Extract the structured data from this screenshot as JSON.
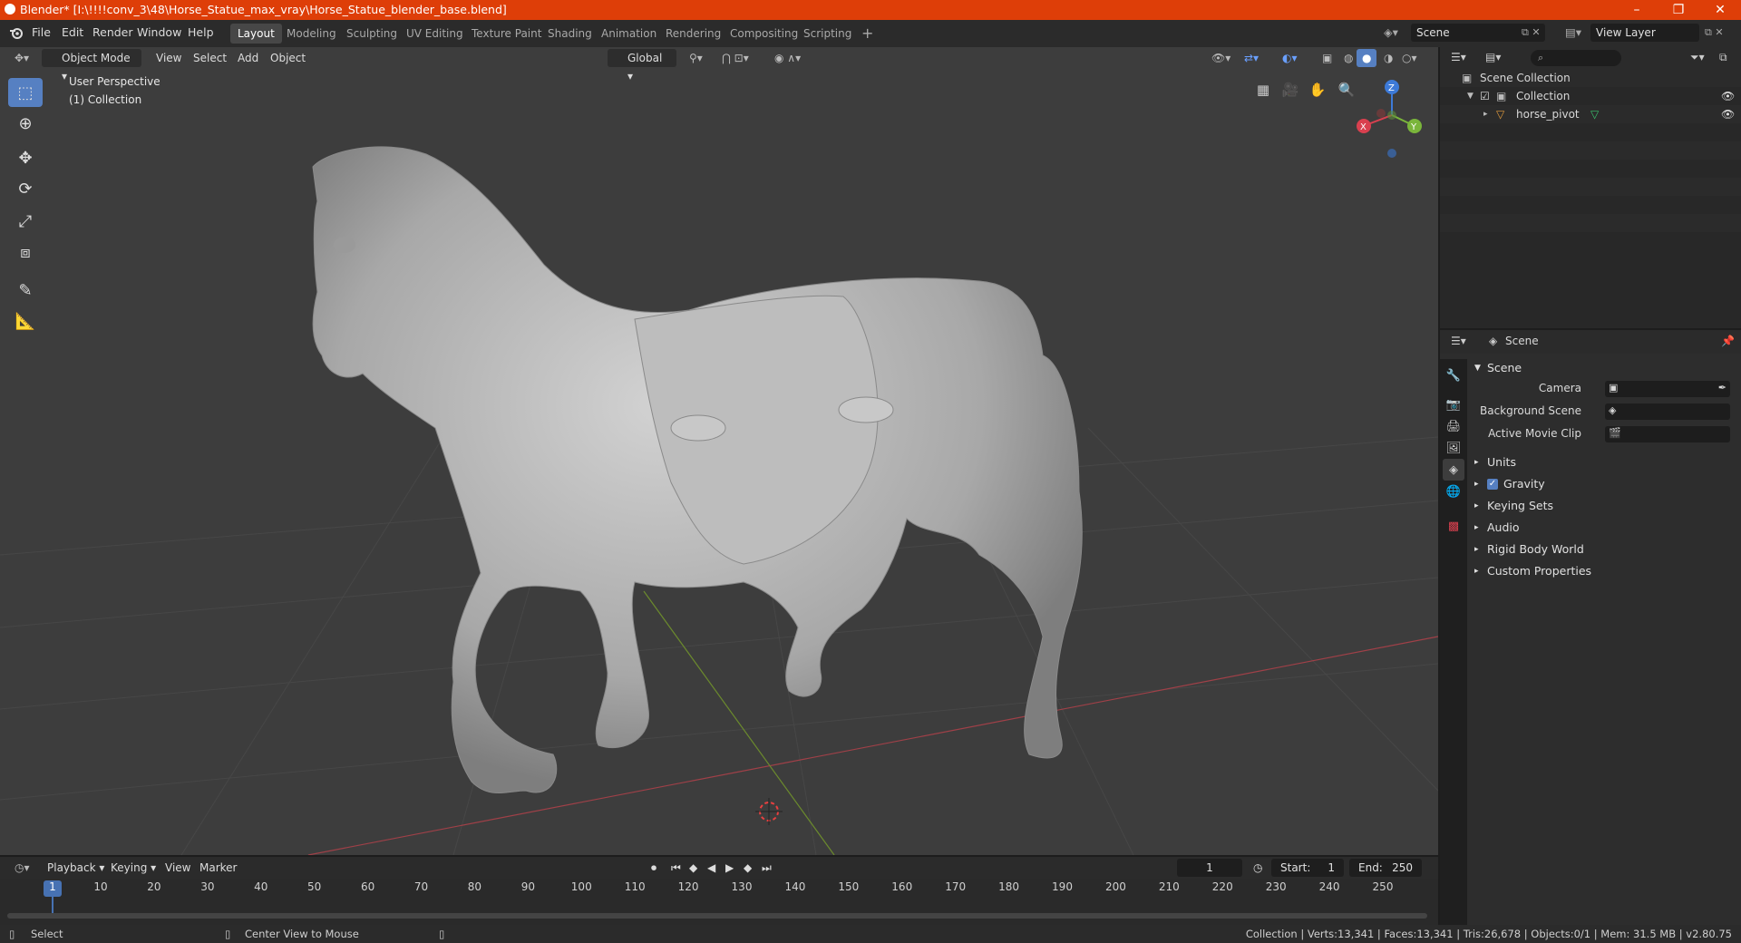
{
  "window": {
    "title": "Blender* [I:\\!!!!conv_3\\48\\Horse_Statue_max_vray\\Horse_Statue_blender_base.blend]",
    "controls": [
      "–",
      "❐",
      "✕"
    ]
  },
  "menu": [
    "File",
    "Edit",
    "Render",
    "Window",
    "Help"
  ],
  "workspaces": [
    "Layout",
    "Modeling",
    "Sculpting",
    "UV Editing",
    "Texture Paint",
    "Shading",
    "Animation",
    "Rendering",
    "Compositing",
    "Scripting"
  ],
  "active_workspace": "Layout",
  "scene_field": "Scene",
  "view_layer_field": "View Layer",
  "viewport": {
    "mode": "Object Mode",
    "menus": [
      "View",
      "Select",
      "Add",
      "Object"
    ],
    "orientation": "Global",
    "perspective_label": "User Perspective",
    "collection_label": "(1) Collection",
    "gizmo_axes": {
      "x": "X",
      "y": "Y",
      "z": "Z"
    }
  },
  "outliner": {
    "scene_collection": "Scene Collection",
    "collection": "Collection",
    "object": "horse_pivot"
  },
  "properties": {
    "header": "Scene",
    "panel_title": "Scene",
    "fields": [
      {
        "label": "Camera"
      },
      {
        "label": "Background Scene"
      },
      {
        "label": "Active Movie Clip"
      }
    ],
    "sections": [
      "Units",
      "Gravity",
      "Keying Sets",
      "Audio",
      "Rigid Body World",
      "Custom Properties"
    ],
    "gravity_checked": true
  },
  "timeline": {
    "menus": [
      "Playback",
      "Keying",
      "View",
      "Marker"
    ],
    "current_frame": "1",
    "start_label": "Start:",
    "start": "1",
    "end_label": "End:",
    "end": "250",
    "ticks": [
      "1",
      "10",
      "20",
      "30",
      "40",
      "50",
      "60",
      "70",
      "80",
      "90",
      "100",
      "110",
      "120",
      "130",
      "140",
      "150",
      "160",
      "170",
      "180",
      "190",
      "200",
      "210",
      "220",
      "230",
      "240",
      "250"
    ]
  },
  "status": {
    "left": "Select",
    "middle": "Center View to Mouse",
    "right": "Collection | Verts:13,341 | Faces:13,341 | Tris:26,678 | Objects:0/1 | Mem: 31.5 MB | v2.80.75"
  },
  "colors": {
    "titlebar": "#de3e08",
    "accent": "#5680c2",
    "x_axis": "#d9404f",
    "y_axis": "#7ab53b",
    "z_axis": "#3d7ad8"
  }
}
